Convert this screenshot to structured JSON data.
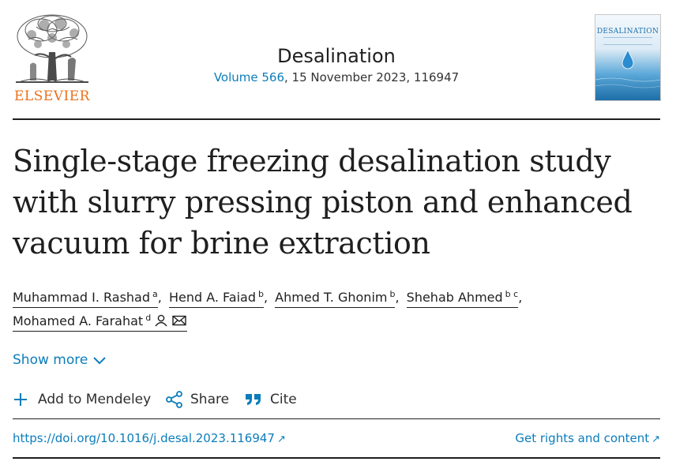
{
  "publisher": {
    "name": "ELSEVIER",
    "brand_color": "#e9711c",
    "logo_icon": "elsevier-tree-logo"
  },
  "journal": {
    "title": "Desalination",
    "volume_link": "Volume 566",
    "issue_info": ", 15 November 2023, 116947",
    "cover_title": "DESALINATION"
  },
  "article": {
    "title": "Single-stage freezing desalination study with slurry pressing piston and enhanced vacuum for brine extraction"
  },
  "authors": [
    {
      "name": "Muhammad I. Rashad",
      "sup": "a"
    },
    {
      "name": "Hend A. Faiad",
      "sup": "b"
    },
    {
      "name": "Ahmed T. Ghonim",
      "sup": "b"
    },
    {
      "name": "Shehab Ahmed",
      "sup": "b c"
    },
    {
      "name": "Mohamed A. Farahat",
      "sup": "d",
      "icons": [
        "person-icon",
        "mail-icon"
      ]
    }
  ],
  "show_more": {
    "label": "Show more",
    "icon": "chevron-down-icon"
  },
  "actions": [
    {
      "label": "Add to Mendeley",
      "icon": "plus-icon"
    },
    {
      "label": "Share",
      "icon": "share-icon"
    },
    {
      "label": "Cite",
      "icon": "quote-icon"
    }
  ],
  "links": {
    "doi": "https://doi.org/10.1016/j.desal.2023.116947",
    "rights": "Get rights and content",
    "external_glyph": "↗"
  },
  "colors": {
    "link": "#0c7dbb",
    "text": "#1f1f1f"
  }
}
